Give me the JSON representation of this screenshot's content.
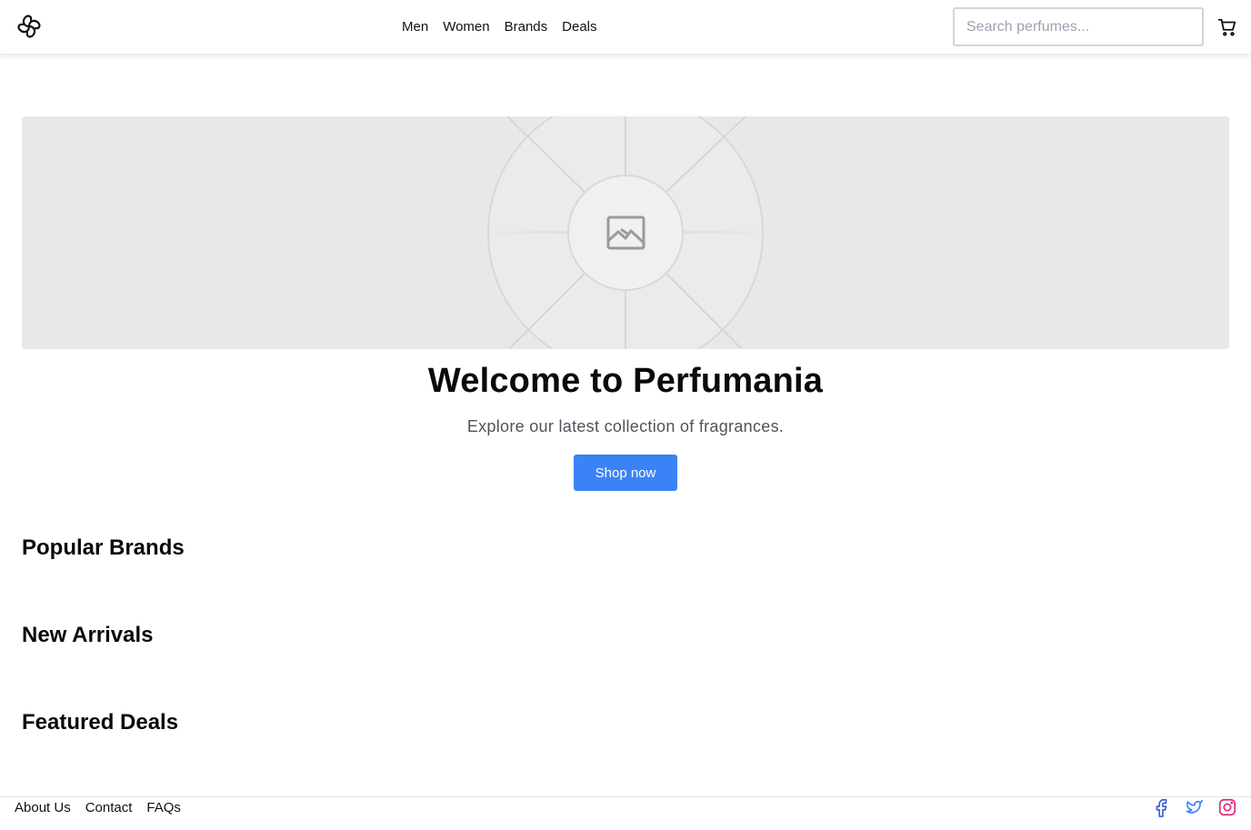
{
  "header": {
    "logo_icon": "pinwheel-logo-icon",
    "nav": [
      {
        "label": "Men"
      },
      {
        "label": "Women"
      },
      {
        "label": "Brands"
      },
      {
        "label": "Deals"
      }
    ],
    "search": {
      "placeholder": "Search perfumes...",
      "value": ""
    },
    "cart_icon": "shopping-cart-icon"
  },
  "hero": {
    "image_icon": "image-placeholder-icon",
    "title": "Welcome to Perfumania",
    "subtitle": "Explore our latest collection of fragrances.",
    "cta_label": "Shop now"
  },
  "sections": {
    "popular_brands": "Popular Brands",
    "new_arrivals": "New Arrivals",
    "featured_deals": "Featured Deals"
  },
  "footer": {
    "links": [
      {
        "label": "About Us"
      },
      {
        "label": "Contact"
      },
      {
        "label": "FAQs"
      }
    ],
    "social": [
      {
        "icon": "facebook-icon",
        "color": "#3b5bdb"
      },
      {
        "icon": "twitter-icon",
        "color": "#3b82f6"
      },
      {
        "icon": "instagram-icon",
        "color": "#db2777"
      }
    ]
  },
  "colors": {
    "accent": "#3b82f6",
    "hero_bg": "#e8e8e8"
  }
}
